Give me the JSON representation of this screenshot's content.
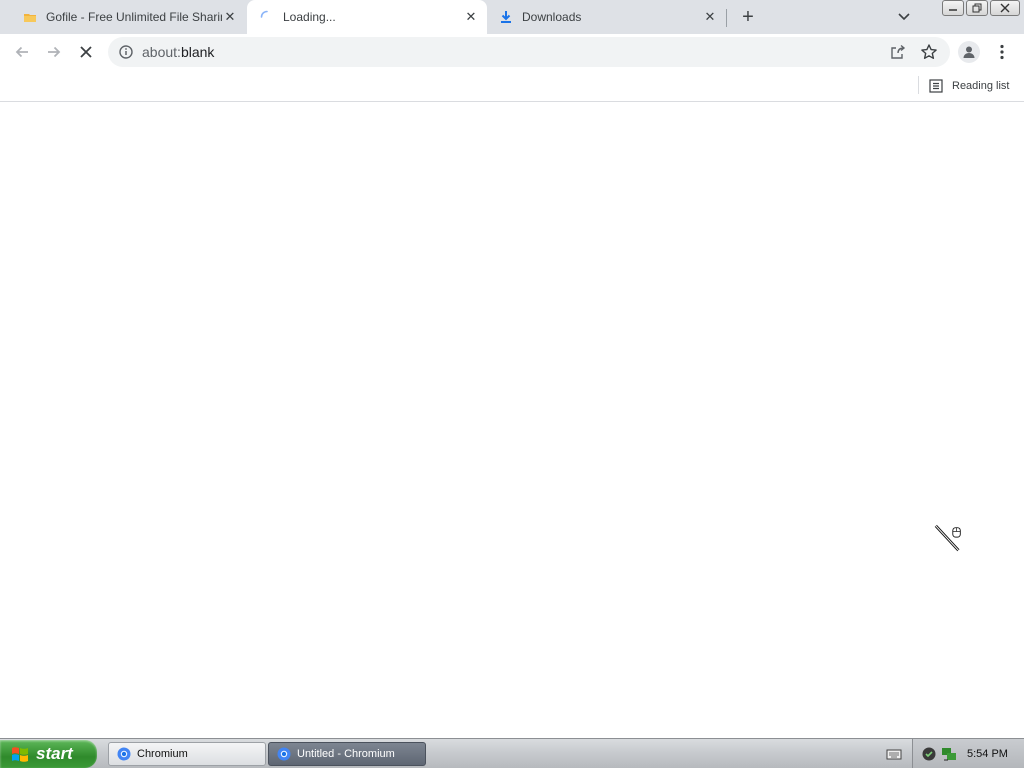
{
  "tabs": [
    {
      "title": "Gofile - Free Unlimited File Sharing and Storage",
      "favicon": "folder-icon"
    },
    {
      "title": "Loading...",
      "favicon": "loading-spinner-icon",
      "active": true
    },
    {
      "title": "Downloads",
      "favicon": "download-icon"
    }
  ],
  "toolbar": {
    "url_scheme": "about:",
    "url_path": "blank"
  },
  "bookmarks": {
    "reading_list_label": "Reading list"
  },
  "taskbar": {
    "start_label": "start",
    "tasks": [
      {
        "label": "Chromium",
        "active": false
      },
      {
        "label": "Untitled - Chromium",
        "active": true
      }
    ],
    "clock": "5:54 PM"
  },
  "colors": {
    "tabstrip": "#dee1e6",
    "download_blue": "#1a73e8",
    "start_green": "#3b9a37",
    "taskbar": "#c6c9cd"
  }
}
